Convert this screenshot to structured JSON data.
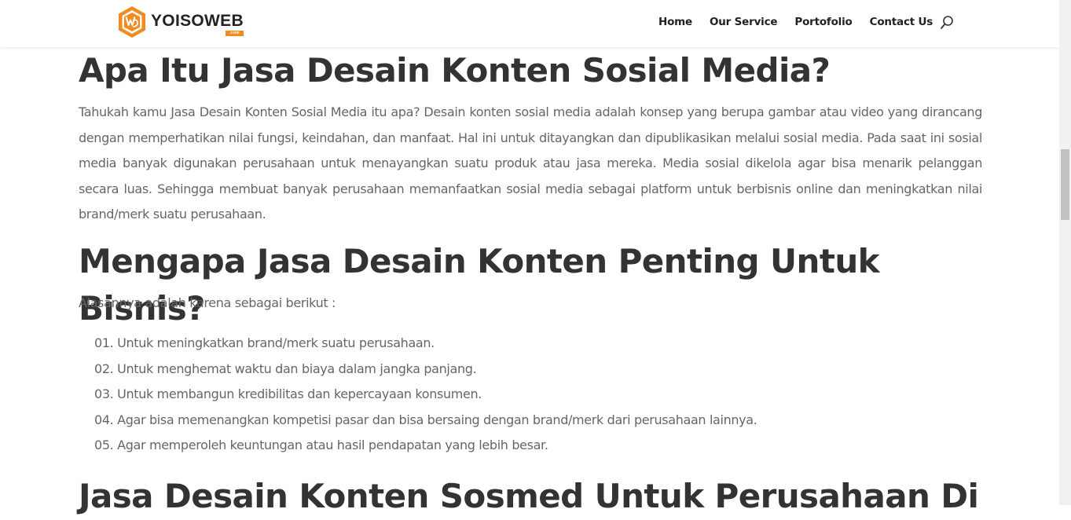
{
  "header": {
    "logo_text": "YOISOWEB",
    "logo_badge": ".com",
    "nav": [
      "Home",
      "Our Service",
      "Portofolio",
      "Contact Us"
    ],
    "search_icon": "search-icon"
  },
  "article": {
    "heading1": "Apa Itu Jasa Desain Konten Sosial Media?",
    "paragraph1": "Tahukah kamu Jasa Desain Konten Sosial Media itu apa? Desain konten sosial media adalah konsep yang berupa gambar atau video yang dirancang dengan memperhatikan nilai fungsi, keindahan, dan manfaat. Hal ini untuk ditayangkan dan dipublikasikan melalui sosial media. Pada saat ini sosial media banyak digunakan perusahaan untuk menayangkan suatu produk atau jasa mereka. Media sosial dikelola agar bisa menarik pelanggan secara luas. Sehingga membuat banyak perusahaan memanfaatkan sosial media sebagai platform untuk berbisnis online dan meningkatkan nilai brand/merk suatu perusahaan.",
    "heading2": "Mengapa Jasa Desain Konten Penting Untuk Bisnis?",
    "paragraph2": "Alasannya adalah karena sebagai berikut :",
    "list": [
      "01. Untuk meningkatkan brand/merk suatu perusahaan.",
      "02. Untuk menghemat waktu dan biaya dalam jangka panjang.",
      "03. Untuk membangun kredibilitas dan kepercayaan konsumen.",
      "04. Agar bisa memenangkan kompetisi pasar dan bisa bersaing dengan brand/merk dari perusahaan lainnya.",
      "05. Agar memperoleh keuntungan atau hasil pendapatan yang lebih besar."
    ],
    "heading3": "Jasa Desain Konten Sosmed Untuk Perusahaan Di"
  },
  "colors": {
    "accent": "#f08c1e",
    "heading": "#333333",
    "body_text": "#666666",
    "nav_text": "#222222"
  }
}
